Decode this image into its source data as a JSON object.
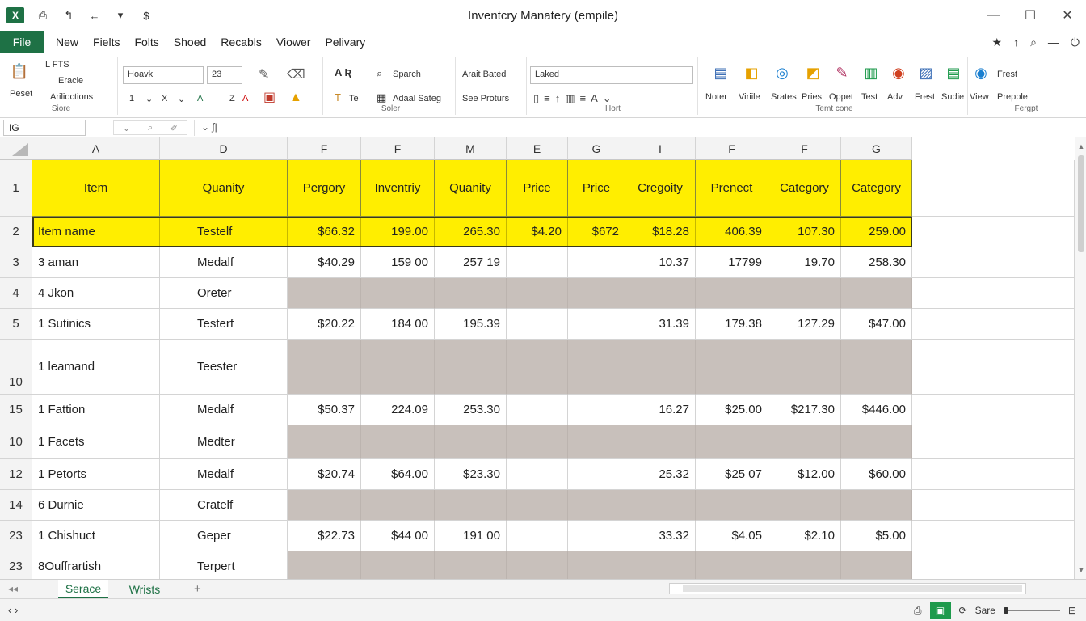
{
  "titlebar": {
    "title": "Inventcry Manatery (empile)",
    "qat": [
      "⎙",
      "↰",
      "←",
      "▾",
      "$"
    ],
    "controls": [
      "—",
      "☐",
      "✕"
    ]
  },
  "menubar": {
    "file_label": "File",
    "tabs": [
      "New",
      "Fielts",
      "Folts",
      "Shoed",
      "Recabls",
      "Viower",
      "Pelivary"
    ],
    "right_icons": [
      "★",
      "↑",
      "⌕",
      "—",
      "⏻"
    ]
  },
  "ribbon": {
    "clipboard": {
      "paste": "Peset",
      "items": [
        "L FTS",
        "Eracle",
        "Arilioctions"
      ],
      "label": "Siore"
    },
    "font": {
      "font_name": "Hoavk",
      "font_size": "23",
      "row2": [
        "1",
        "⌄",
        "X",
        "⌄",
        "A",
        "Z",
        "A"
      ]
    },
    "styles": {
      "find": "Sparch",
      "fill": "Te",
      "adv": "Adaal Sateg",
      "label": "Soler"
    },
    "number": {
      "top": "Arait Bated",
      "bottom": "See Proturs",
      "label": ""
    },
    "format": {
      "value": "Laked",
      "label": "Hort"
    },
    "tools": [
      "Noter",
      "Viriile",
      "Srates",
      "Pries",
      "Oppet",
      "Test",
      "Adv",
      "Frest",
      "Sudie",
      "View",
      "Prepple"
    ],
    "tools_label": "Temt cone",
    "right_top": "Frest",
    "right_label": "Fergpt"
  },
  "formula_bar": {
    "name_box": "IG",
    "ctrl_icons": [
      "⌄",
      "⌕",
      "✐"
    ],
    "content": "⌄ ∫|"
  },
  "grid": {
    "columns": [
      "A",
      "D",
      "F",
      "F",
      "M",
      "E",
      "G",
      "I",
      "F",
      "F",
      "G"
    ],
    "header_row": {
      "num": "1",
      "cells": [
        "Item",
        "Quanity",
        "Pergory",
        "Inventriy",
        "Quanity",
        "Price",
        "Price",
        "Cregoity",
        "Prenect",
        "Category",
        "Category"
      ]
    },
    "rows": [
      {
        "num": "2",
        "cells": [
          "Item name",
          "Testelf",
          "$66.32",
          "199.00",
          "265.30",
          "$4.20",
          "$672",
          "$18.28",
          "406.39",
          "107.30",
          "259.00"
        ],
        "style": "yellow"
      },
      {
        "num": "3",
        "cells": [
          "3 aman",
          "Medalf",
          "$40.29",
          "159 00",
          "257 19",
          "",
          "",
          "10.37",
          "17799",
          "19.70",
          "258.30"
        ],
        "style": "white"
      },
      {
        "num": "4",
        "cells": [
          "4 Jkon",
          "Oreter",
          "",
          "",
          "",
          "",
          "",
          "",
          "",
          "",
          ""
        ],
        "style": "gray"
      },
      {
        "num": "5",
        "cells": [
          "1 Sutinics",
          "Testerf",
          "$20.22",
          "184 00",
          "195.39",
          "",
          "",
          "31.39",
          "179.38",
          "127.29",
          "$47.00"
        ],
        "style": "white"
      },
      {
        "num": "10",
        "cells": [
          "1 leamand",
          "Teester",
          "",
          "",
          "",
          "",
          "",
          "",
          "",
          "",
          ""
        ],
        "style": "gray"
      },
      {
        "num": "15",
        "cells": [
          "1 Fattion",
          "Medalf",
          "$50.37",
          "224.09",
          "253.30",
          "",
          "",
          "16.27",
          "$25.00",
          "$217.30",
          "$446.00"
        ],
        "style": "white"
      },
      {
        "num": "10",
        "cells": [
          "1 Facets",
          "Medter",
          "",
          "",
          "",
          "",
          "",
          "",
          "",
          "",
          ""
        ],
        "style": "gray"
      },
      {
        "num": "12",
        "cells": [
          "1 Petorts",
          "Medalf",
          "$20.74",
          "$64.00",
          "$23.30",
          "",
          "",
          "25.32",
          "$25 07",
          "$12.00",
          "$60.00"
        ],
        "style": "white"
      },
      {
        "num": "14",
        "cells": [
          "6 Durnie",
          "Cratelf",
          "",
          "",
          "",
          "",
          "",
          "",
          "",
          "",
          ""
        ],
        "style": "gray"
      },
      {
        "num": "23",
        "cells": [
          "1 Chishuct",
          "Geper",
          "$22.73",
          "$44 00",
          "191 00",
          "",
          "",
          "33.32",
          "$4.05",
          "$2.10",
          "$5.00"
        ],
        "style": "white"
      },
      {
        "num": "23",
        "cells": [
          "8Ouffrartish",
          "Terpert",
          "",
          "",
          "",
          "",
          "",
          "",
          "",
          "",
          ""
        ],
        "style": "gray"
      }
    ]
  },
  "sheets": {
    "tabs": [
      "Serace",
      "Wrists"
    ],
    "active_index": 0,
    "add": "+",
    "nav": "◂◂"
  },
  "statusbar": {
    "nav": "‹ ›",
    "save_label": "Sare",
    "icons": [
      "⎙",
      "⊟"
    ]
  },
  "colors": {
    "accent": "#1e7145",
    "highlight": "#ffee00",
    "shaded": "#c8c0bb"
  }
}
